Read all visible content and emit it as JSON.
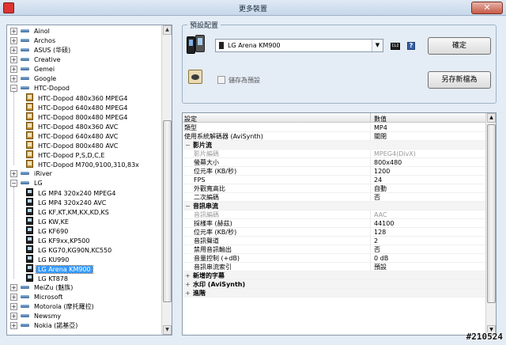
{
  "window": {
    "title": "更多裝置",
    "close_label": "✕"
  },
  "tree": {
    "nodes": [
      {
        "label": "Ainol",
        "kind": "brand",
        "expander": "+"
      },
      {
        "label": "Archos",
        "kind": "brand",
        "expander": "+"
      },
      {
        "label": "ASUS (华硕)",
        "kind": "brand",
        "expander": "+"
      },
      {
        "label": "Creative",
        "kind": "brand",
        "expander": "+"
      },
      {
        "label": "Gemei",
        "kind": "brand",
        "expander": "+"
      },
      {
        "label": "Google",
        "kind": "brand",
        "expander": "+"
      },
      {
        "label": "HTC-Dopod",
        "kind": "brand",
        "expander": "−"
      },
      {
        "label": "HTC-Dopod 480x360 MPEG4",
        "kind": "htc",
        "child": true
      },
      {
        "label": "HTC-Dopod 640x480 MPEG4",
        "kind": "htc",
        "child": true
      },
      {
        "label": "HTC-Dopod 800x480 MPEG4",
        "kind": "htc",
        "child": true
      },
      {
        "label": "HTC-Dopod 480x360 AVC",
        "kind": "htc",
        "child": true
      },
      {
        "label": "HTC-Dopod 640x480 AVC",
        "kind": "htc",
        "child": true
      },
      {
        "label": "HTC-Dopod 800x480 AVC",
        "kind": "htc",
        "child": true
      },
      {
        "label": "HTC-Dopod P,S,D,C,E",
        "kind": "htc",
        "child": true
      },
      {
        "label": "HTC-Dopod M700,9100,310,83x",
        "kind": "htc",
        "child": true
      },
      {
        "label": "iRiver",
        "kind": "brand",
        "expander": "+"
      },
      {
        "label": "LG",
        "kind": "brand",
        "expander": "−"
      },
      {
        "label": "LG MP4 320x240 MPEG4",
        "kind": "lg",
        "child": true
      },
      {
        "label": "LG MP4 320x240 AVC",
        "kind": "lg",
        "child": true
      },
      {
        "label": "LG KF,KT,KM,KX,KD,KS",
        "kind": "lg",
        "child": true
      },
      {
        "label": "LG KW,KE",
        "kind": "lg",
        "child": true
      },
      {
        "label": "LG KF690",
        "kind": "lg",
        "child": true
      },
      {
        "label": "LG KF9xx,KP500",
        "kind": "lg",
        "child": true
      },
      {
        "label": "LG KG70,KG90N,KC550",
        "kind": "lg",
        "child": true
      },
      {
        "label": "LG KU990",
        "kind": "lg",
        "child": true
      },
      {
        "label": "LG Arena KM900",
        "kind": "lg",
        "child": true,
        "selected": true
      },
      {
        "label": "LG KT878",
        "kind": "lg",
        "child": true
      },
      {
        "label": "MeiZu (魅族)",
        "kind": "brand",
        "expander": "+"
      },
      {
        "label": "Microsoft",
        "kind": "brand",
        "expander": "+"
      },
      {
        "label": "Motorola (摩托羅拉)",
        "kind": "brand",
        "expander": "+"
      },
      {
        "label": "Newsmy",
        "kind": "brand",
        "expander": "+"
      },
      {
        "label": "Nokia (諾基亞)",
        "kind": "brand",
        "expander": "+"
      }
    ]
  },
  "preset": {
    "legend": "預設配置",
    "selected": "LG Arena KM900",
    "cli_label": "CLI",
    "help_label": "?",
    "ok_label": "確定",
    "checkbox_label": "儲存為預設",
    "saveas_label": "另存新檔為"
  },
  "grid": {
    "header": {
      "key": "設定",
      "value": "數值"
    },
    "rows": [
      {
        "k": "類型",
        "v": "MP4"
      },
      {
        "k": "使用系統解碼器 (AviSynth)",
        "v": "關閉"
      },
      {
        "k": "影片流",
        "type": "cat",
        "tog": "−"
      },
      {
        "k": "影片編碼",
        "v": "MPEG4(DivX)",
        "type": "sub",
        "dim": true
      },
      {
        "k": "螢幕大小",
        "v": "800x480",
        "type": "sub"
      },
      {
        "k": "位元率 (KB/秒)",
        "v": "1200",
        "type": "sub"
      },
      {
        "k": "FPS",
        "v": "24",
        "type": "sub"
      },
      {
        "k": "外觀寬高比",
        "v": "自動",
        "type": "sub"
      },
      {
        "k": "二次編碼",
        "v": "否",
        "type": "sub"
      },
      {
        "k": "音訊串流",
        "type": "cat",
        "tog": "−"
      },
      {
        "k": "音訊編碼",
        "v": "AAC",
        "type": "sub",
        "dim": true
      },
      {
        "k": "採樣率 (赫茲)",
        "v": "44100",
        "type": "sub"
      },
      {
        "k": "位元率 (KB/秒)",
        "v": "128",
        "type": "sub"
      },
      {
        "k": "音訊聲道",
        "v": "2",
        "type": "sub"
      },
      {
        "k": "禁用音訊輸出",
        "v": "否",
        "type": "sub"
      },
      {
        "k": "音量控制 (+dB)",
        "v": "0 dB",
        "type": "sub"
      },
      {
        "k": "音訊串流索引",
        "v": "預設",
        "type": "sub"
      },
      {
        "k": "新增的字幕",
        "type": "cat",
        "tog": "+"
      },
      {
        "k": "水印 (AviSynth)",
        "type": "cat",
        "tog": "+"
      },
      {
        "k": "進階",
        "type": "cat",
        "tog": "+"
      }
    ]
  },
  "watermark": "#210524",
  "colors": {
    "selection": "#3399ff",
    "frame": "#e4ecf5"
  }
}
